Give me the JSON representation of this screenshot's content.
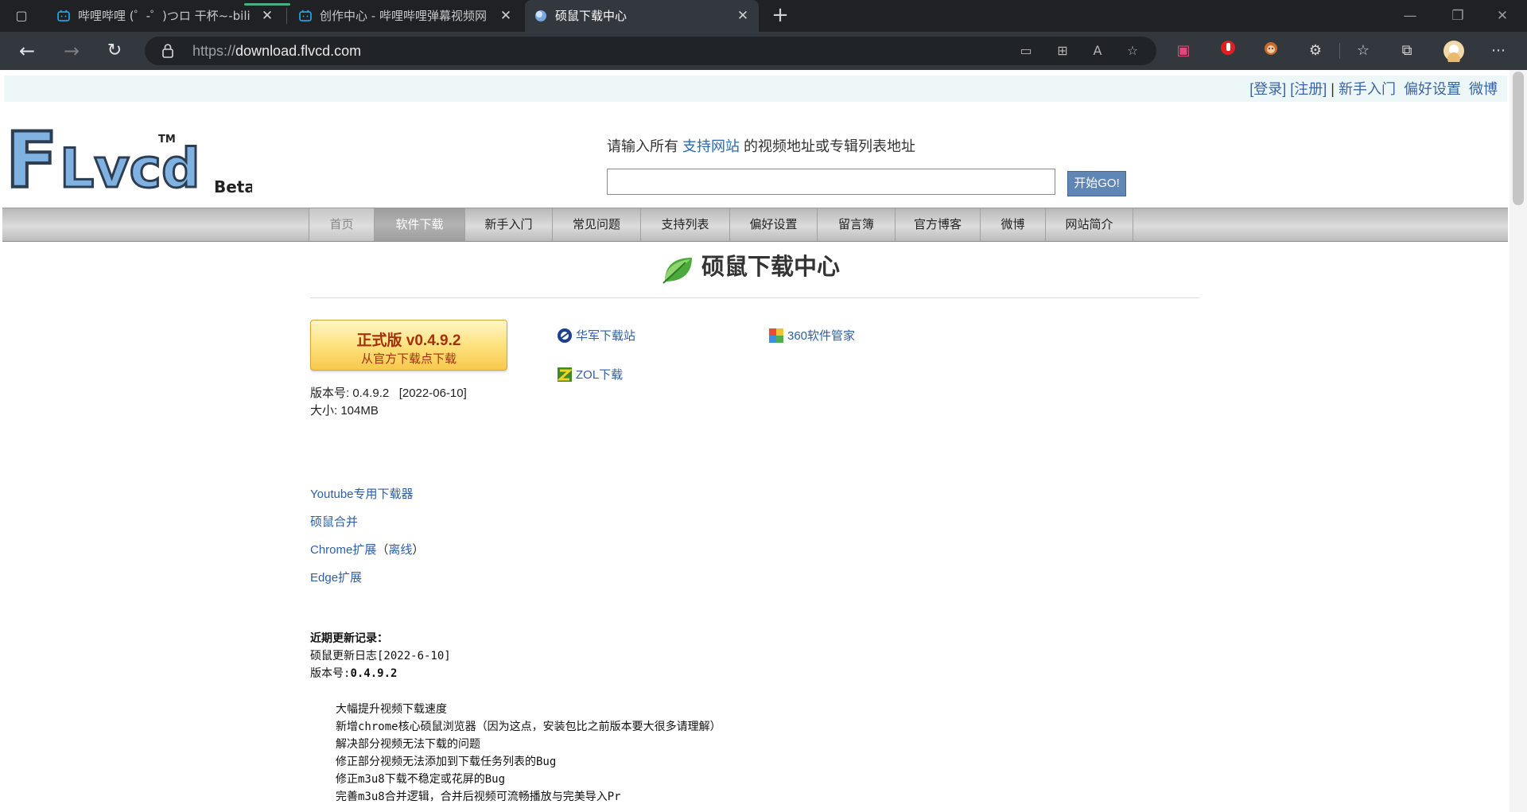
{
  "browser": {
    "tabs": [
      {
        "title": "哔哩哔哩 (゜-゜)つロ 干杯~-bilibili",
        "active": false
      },
      {
        "title": "创作中心 - 哔哩哔哩弹幕视频网",
        "active": false
      },
      {
        "title": "硕鼠下载中心",
        "active": true
      }
    ],
    "url_scheme": "https://",
    "url_host": "download.flvcd.com"
  },
  "colors": {
    "link": "#2e5fa6",
    "accent_button": "#5f86b4",
    "download_button": "#fde07a"
  },
  "top_links": {
    "login": "[登录]",
    "register": "[注册]",
    "sep": "|",
    "newbie": "新手入门",
    "prefs": "偏好设置",
    "weibo": "微博"
  },
  "logo": {
    "text": "FLvcd",
    "tm": "TM",
    "beta": "Beta"
  },
  "search": {
    "hint_before": "请输入所有",
    "hint_link": "支持网站",
    "hint_after": "的视频地址或专辑列表地址",
    "value": "",
    "button": "开始GO!"
  },
  "nav": [
    "首页",
    "软件下载",
    "新手入门",
    "常见问题",
    "支持列表",
    "偏好设置",
    "留言簿",
    "官方博客",
    "微博",
    "网站简介"
  ],
  "section_title": "硕鼠下载中心",
  "download": {
    "label": "正式版 v0.4.9.2",
    "sub": "从官方下载点下载",
    "version": "版本号: 0.4.9.2   [2022-06-10]",
    "size": "大小: 104MB"
  },
  "mirrors": [
    {
      "name": "华军下载站",
      "icon": "huajun-icon"
    },
    {
      "name": "360软件管家",
      "icon": "360-icon"
    },
    {
      "name": "ZOL下载",
      "icon": "zol-icon"
    }
  ],
  "product_links": {
    "youtube": "Youtube专用下载器",
    "merge": "硕鼠合并",
    "chrome": "Chrome扩展",
    "chrome_open": "（",
    "chrome_offline": "离线",
    "chrome_close": "）",
    "edge": "Edge扩展"
  },
  "changelog": {
    "heading": "近期更新记录：",
    "title": "硕鼠更新日志[2022-6-10]",
    "version_label": "版本号:",
    "version": "0.4.9.2",
    "items": [
      "大幅提升视频下载速度",
      "新增chrome核心硕鼠浏览器（因为这点，安装包比之前版本要大很多请理解）",
      "解决部分视频无法下载的问题",
      "修正部分视频无法添加到下载任务列表的Bug",
      "修正m3u8下载不稳定或花屏的Bug",
      "完善m3u8合并逻辑，合并后视频可流畅播放与完美导入Pr"
    ]
  }
}
